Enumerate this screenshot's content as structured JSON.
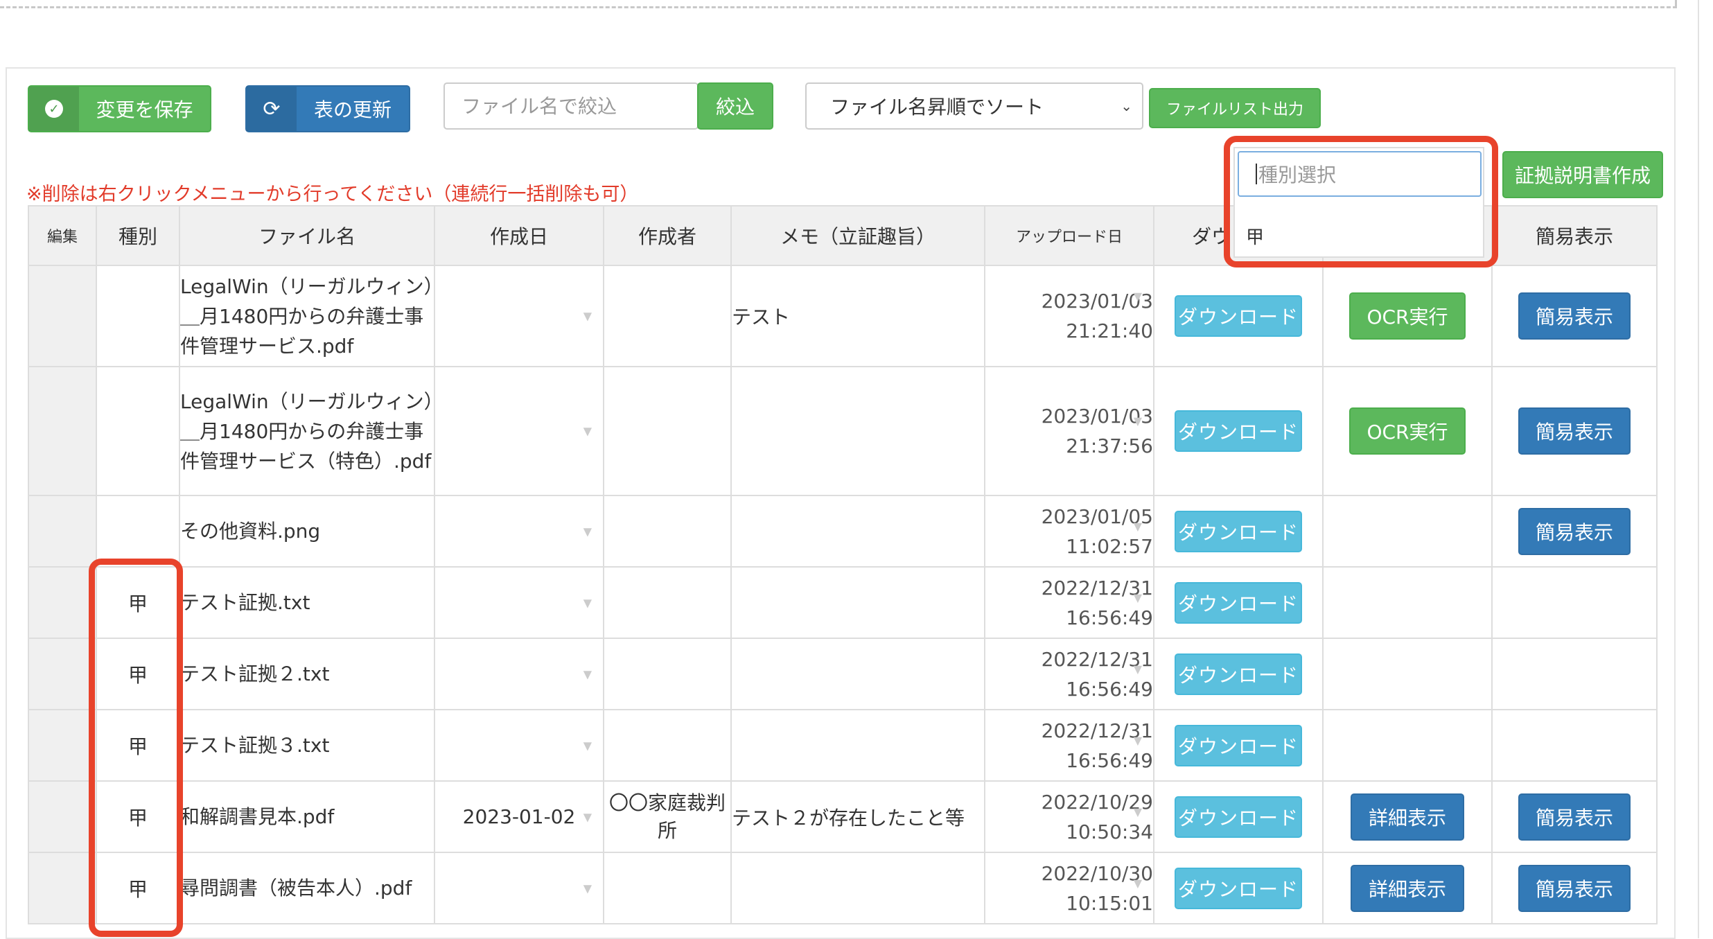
{
  "toolbar": {
    "save_label": "変更を保存",
    "refresh_label": "表の更新",
    "filter_placeholder": "ファイル名で絞込",
    "filter_button": "絞込",
    "sort_selected": "ファイル名昇順でソート",
    "export_label": "ファイルリスト出力",
    "evidence_doc_label": "証拠説明書作成"
  },
  "warning": "※削除は右クリックメニューから行ってください（連続行一括削除も可）",
  "dropdown": {
    "placeholder": "種別選択",
    "options": [
      "甲"
    ]
  },
  "table": {
    "headers": [
      "編集",
      "種別",
      "ファイル名",
      "作成日",
      "作成者",
      "メモ（立証趣旨）",
      "アップロード日",
      "ダウン",
      "",
      "簡易表示"
    ],
    "download_label": "ダウンロード",
    "ocr_label": "OCR実行",
    "detail_label": "詳細表示",
    "simple_label": "簡易表示",
    "rows": [
      {
        "kind": "",
        "filename": "LegalWin（リーガルウィン）＿月1480円からの弁護士事件管理サービス.pdf",
        "created": "",
        "author": "",
        "memo": "テスト",
        "uploaded_date": "2023/01/03",
        "uploaded_time": "21:21:40",
        "action": "ocr",
        "simple": true
      },
      {
        "kind": "",
        "filename": "LegalWin（リーガルウィン）＿月1480円からの弁護士事件管理サービス（特色）.pdf",
        "created": "",
        "author": "",
        "memo": "",
        "uploaded_date": "2023/01/03",
        "uploaded_time": "21:37:56",
        "action": "ocr",
        "simple": true
      },
      {
        "kind": "",
        "filename": "その他資料.png",
        "created": "",
        "author": "",
        "memo": "",
        "uploaded_date": "2023/01/05",
        "uploaded_time": "11:02:57",
        "action": "",
        "simple": true
      },
      {
        "kind": "甲",
        "filename": "テスト証拠.txt",
        "created": "",
        "author": "",
        "memo": "",
        "uploaded_date": "2022/12/31",
        "uploaded_time": "16:56:49",
        "action": "",
        "simple": false
      },
      {
        "kind": "甲",
        "filename": "テスト証拠２.txt",
        "created": "",
        "author": "",
        "memo": "",
        "uploaded_date": "2022/12/31",
        "uploaded_time": "16:56:49",
        "action": "",
        "simple": false
      },
      {
        "kind": "甲",
        "filename": "テスト証拠３.txt",
        "created": "",
        "author": "",
        "memo": "",
        "uploaded_date": "2022/12/31",
        "uploaded_time": "16:56:49",
        "action": "",
        "simple": false
      },
      {
        "kind": "甲",
        "filename": "和解調書見本.pdf",
        "created": "2023-01-02",
        "author": "〇〇家庭裁判所",
        "memo": "テスト２が存在したこと等",
        "uploaded_date": "2022/10/29",
        "uploaded_time": "10:50:34",
        "action": "detail",
        "simple": true
      },
      {
        "kind": "甲",
        "filename": "尋問調書（被告本人）.pdf",
        "created": "",
        "author": "",
        "memo": "",
        "uploaded_date": "2022/10/30",
        "uploaded_time": "10:15:01",
        "action": "detail",
        "simple": true
      }
    ]
  },
  "colors": {
    "green": "#5cb85c",
    "blue": "#337ab7",
    "light_blue": "#5bc0de",
    "highlight": "#e8432b"
  }
}
